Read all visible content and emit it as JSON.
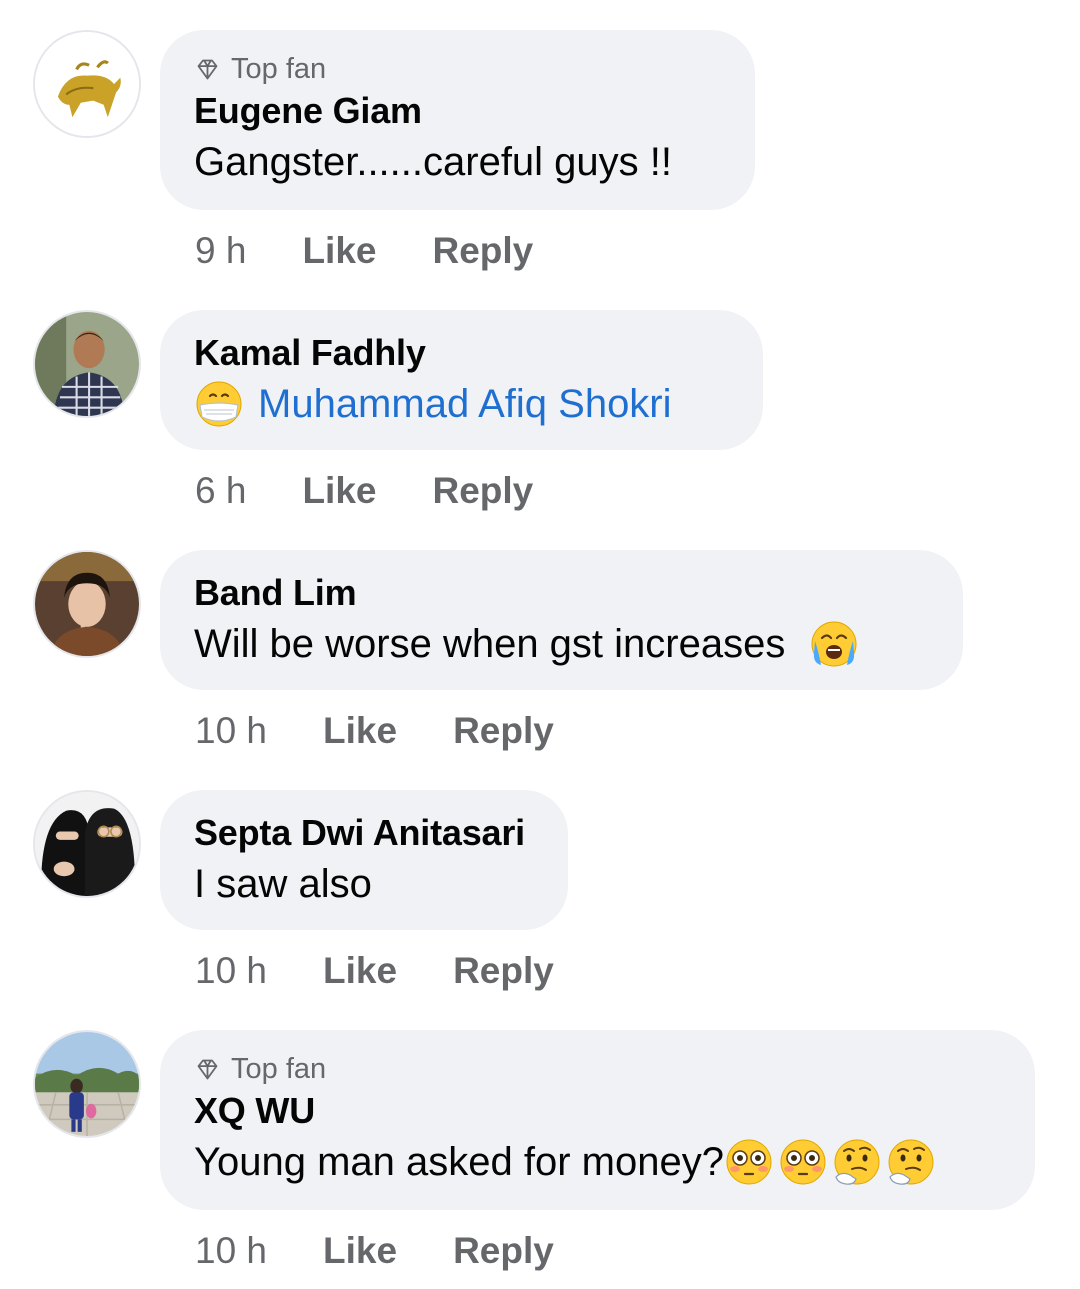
{
  "comments": [
    {
      "badge": "Top fan",
      "name": "Eugene Giam",
      "text": "Gangster......careful guys !!",
      "time": "9 h",
      "like": "Like",
      "reply": "Reply"
    },
    {
      "name": "Kamal Fadhly",
      "mention": "Muhammad Afiq Shokri",
      "emoji": "face-with-medical-mask",
      "time": "6 h",
      "like": "Like",
      "reply": "Reply"
    },
    {
      "name": "Band Lim",
      "text": "Will be worse when gst increases",
      "emoji": "loudly-crying-face",
      "time": "10 h",
      "like": "Like",
      "reply": "Reply"
    },
    {
      "name": "Septa Dwi Anitasari",
      "text": "I saw also",
      "time": "10 h",
      "like": "Like",
      "reply": "Reply"
    },
    {
      "badge": "Top fan",
      "name": "XQ WU",
      "text": "Young man asked for money?",
      "emojis": [
        "flushed-face",
        "flushed-face",
        "thinking-face",
        "thinking-face"
      ],
      "time": "10 h",
      "like": "Like",
      "reply": "Reply"
    }
  ],
  "colors": {
    "bubble": "#f0f2f5",
    "meta_text": "#65676b",
    "mention": "#1f6fd1"
  }
}
